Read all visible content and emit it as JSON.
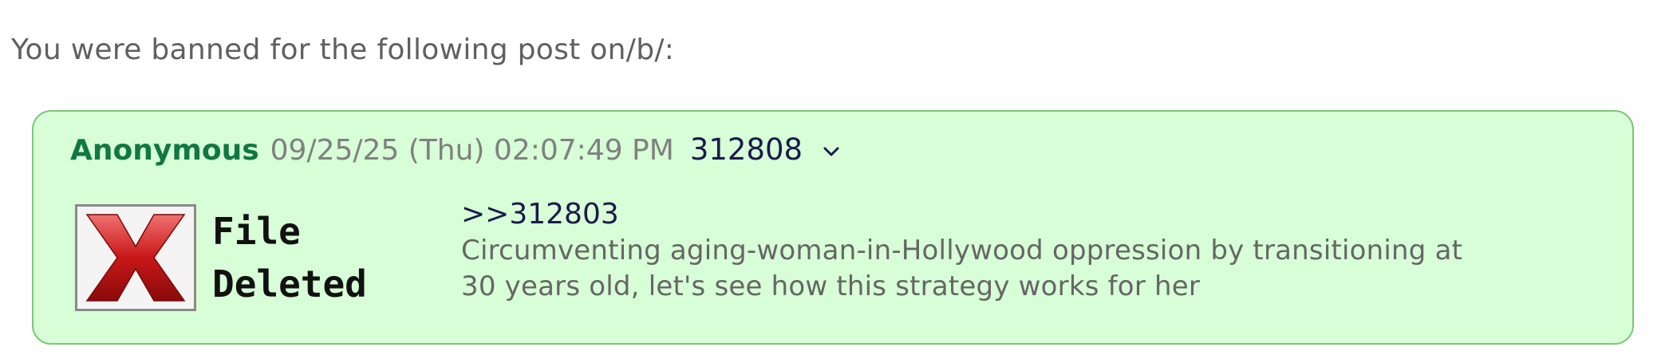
{
  "ban_notice": "You were banned for the following post on/b/:",
  "post": {
    "name": "Anonymous",
    "date": "09/25/25 (Thu) 02:07:49 PM",
    "number": "312808",
    "menu_icon": "chevron-down-icon",
    "file": {
      "deleted_line1": "File",
      "deleted_line2": "Deleted",
      "icon": "file-deleted-icon"
    },
    "quote": ">>312803",
    "message_line1": "Circumventing aging-woman-in-Hollywood oppression by transitioning at",
    "message_line2": "30 years old, let's see how this strategy works for her"
  },
  "colors": {
    "post_background": "#d7fed6",
    "post_border": "#7dc77b",
    "name": "#117743",
    "x_red": "#b01010"
  }
}
